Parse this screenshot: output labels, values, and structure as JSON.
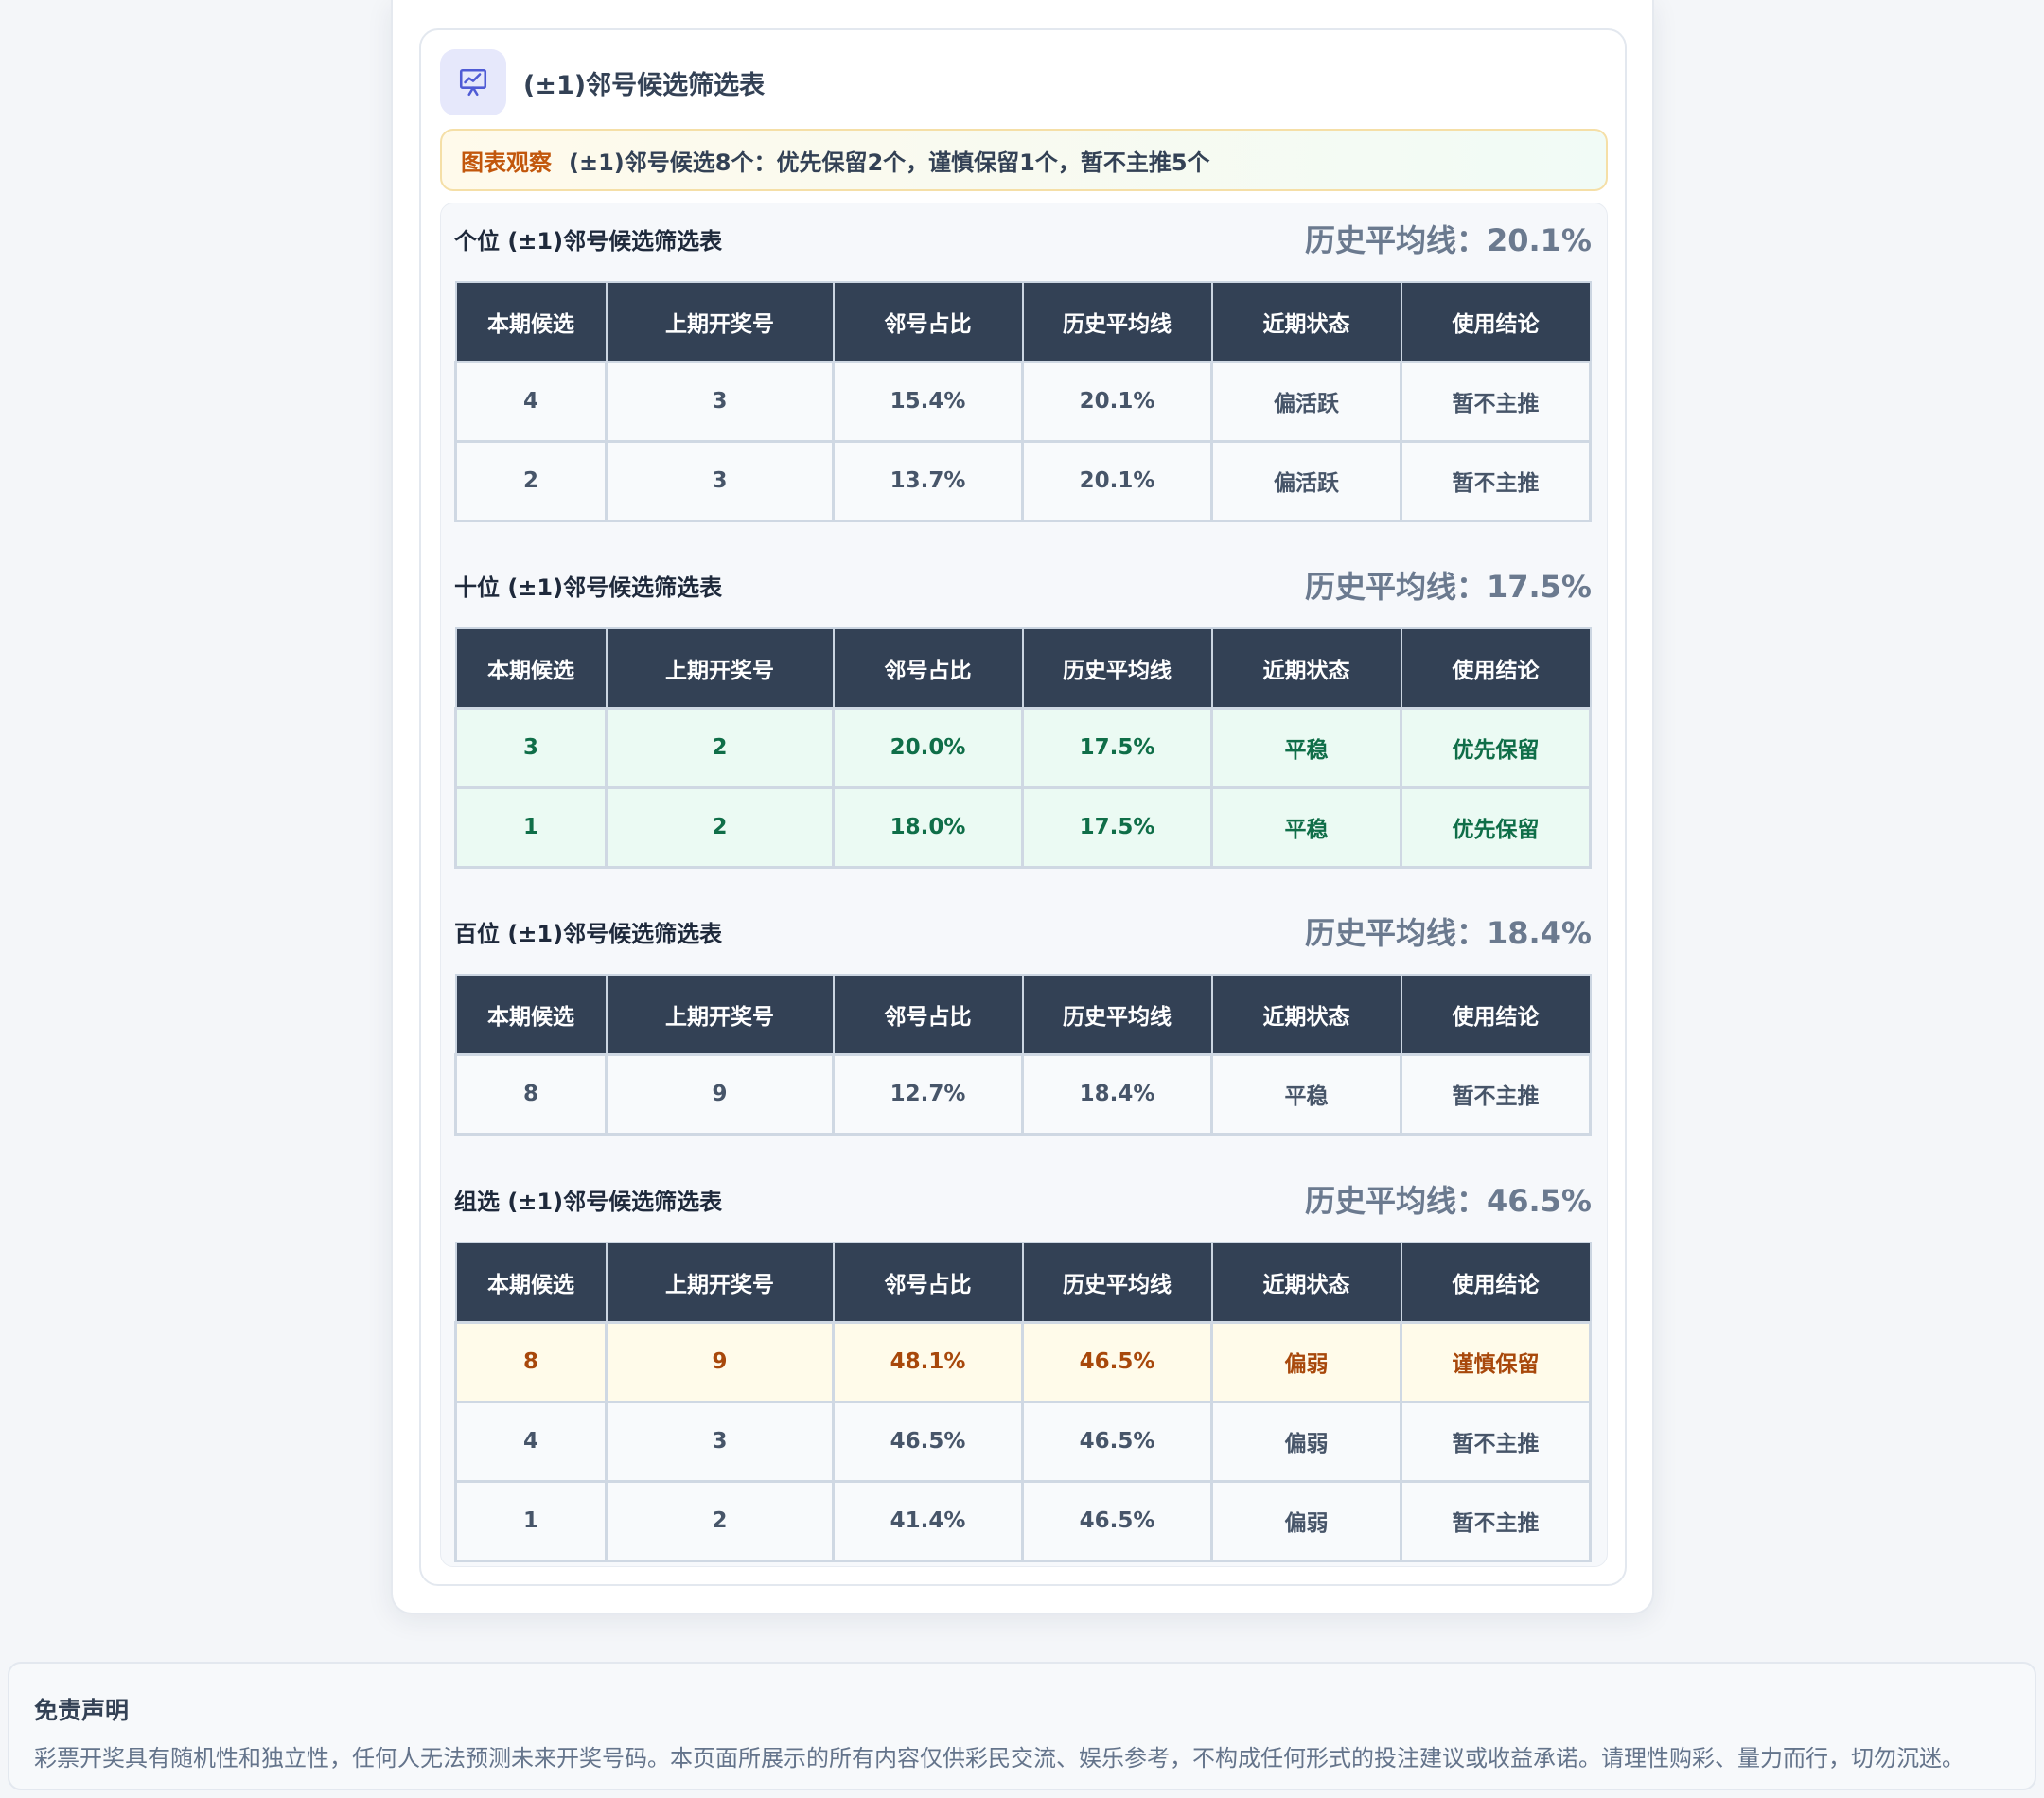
{
  "card": {
    "title": "(±1)邻号候选筛选表",
    "icon": "presentation-chart-icon"
  },
  "observation": {
    "label": "图表观察",
    "text": "(±1)邻号候选8个：优先保留2个，谨慎保留1个，暂不主推5个"
  },
  "columns": [
    "本期候选",
    "上期开奖号",
    "邻号占比",
    "历史平均线",
    "近期状态",
    "使用结论"
  ],
  "sections": [
    {
      "title": "个位 (±1)邻号候选筛选表",
      "avg": "历史平均线：20.1%",
      "rows": [
        {
          "status": "normal",
          "cells": [
            "4",
            "3",
            "15.4%",
            "20.1%",
            "偏活跃",
            "暂不主推"
          ]
        },
        {
          "status": "normal",
          "cells": [
            "2",
            "3",
            "13.7%",
            "20.1%",
            "偏活跃",
            "暂不主推"
          ]
        }
      ]
    },
    {
      "title": "十位 (±1)邻号候选筛选表",
      "avg": "历史平均线：17.5%",
      "rows": [
        {
          "status": "keep",
          "cells": [
            "3",
            "2",
            "20.0%",
            "17.5%",
            "平稳",
            "优先保留"
          ]
        },
        {
          "status": "keep",
          "cells": [
            "1",
            "2",
            "18.0%",
            "17.5%",
            "平稳",
            "优先保留"
          ]
        }
      ]
    },
    {
      "title": "百位 (±1)邻号候选筛选表",
      "avg": "历史平均线：18.4%",
      "rows": [
        {
          "status": "normal",
          "cells": [
            "8",
            "9",
            "12.7%",
            "18.4%",
            "平稳",
            "暂不主推"
          ]
        }
      ]
    },
    {
      "title": "组选 (±1)邻号候选筛选表",
      "avg": "历史平均线：46.5%",
      "rows": [
        {
          "status": "caution",
          "cells": [
            "8",
            "9",
            "48.1%",
            "46.5%",
            "偏弱",
            "谨慎保留"
          ]
        },
        {
          "status": "normal",
          "cells": [
            "4",
            "3",
            "46.5%",
            "46.5%",
            "偏弱",
            "暂不主推"
          ]
        },
        {
          "status": "normal",
          "cells": [
            "1",
            "2",
            "41.4%",
            "46.5%",
            "偏弱",
            "暂不主推"
          ]
        }
      ]
    }
  ],
  "disclaimer": {
    "title": "免责声明",
    "text": "彩票开奖具有随机性和独立性，任何人无法预测未来开奖号码。本页面所展示的所有内容仅供彩民交流、娱乐参考，不构成任何形式的投注建议或收益承诺。请理性购彩、量力而行，切勿沉迷。"
  },
  "colors": {
    "header_bg": "#334155",
    "keep_bg": "#ebfaf3",
    "keep_text": "#0f6e48",
    "caution_bg": "#fffbea",
    "caution_text": "#a8480b",
    "observe_label": "#c2570c"
  }
}
